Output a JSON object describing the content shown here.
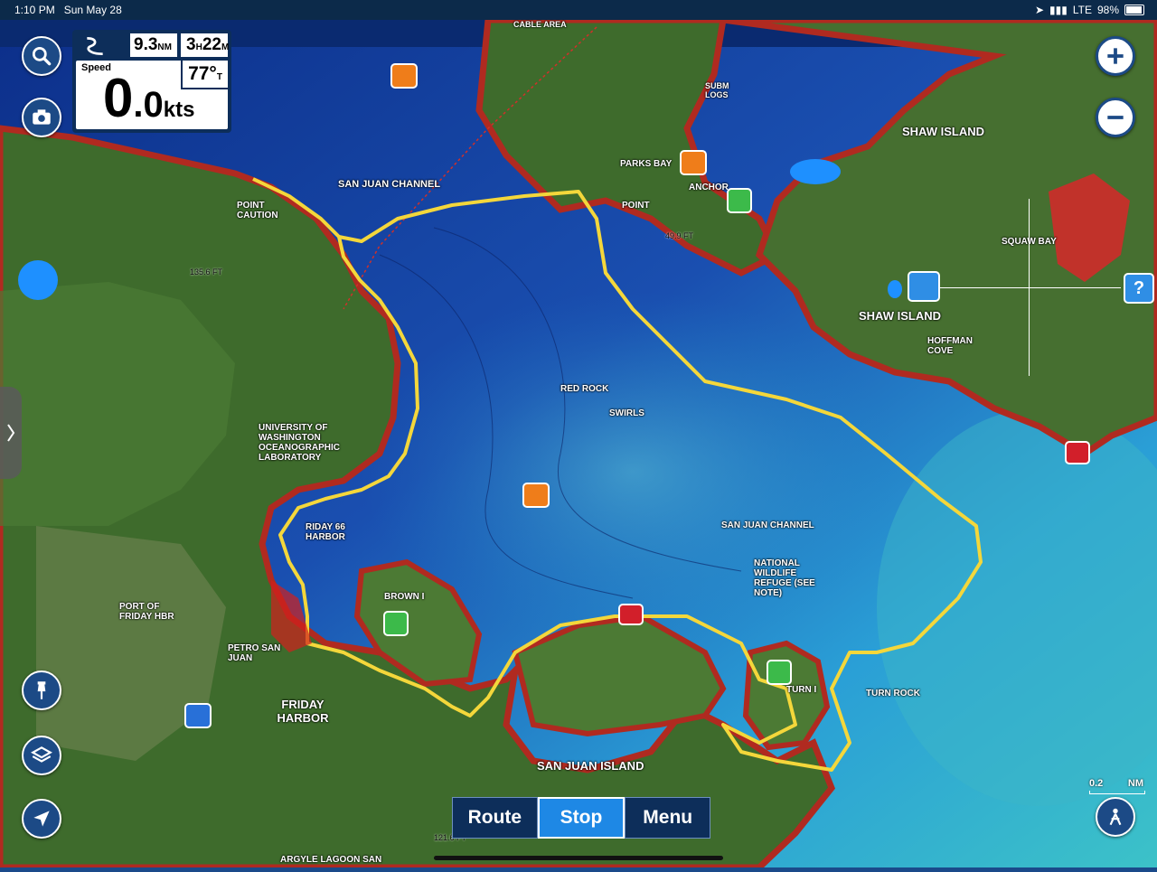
{
  "status_bar": {
    "time": "1:10 PM",
    "date": "Sun May 28",
    "signal": "LTE",
    "battery": "98%"
  },
  "nav_panel": {
    "distance": "9.3",
    "distance_unit": "NM",
    "time_h": "3",
    "time_h_unit": "H",
    "time_m": "22",
    "time_m_unit": "M",
    "speed_label": "Speed",
    "speed_int": "0",
    "speed_dec": ".0",
    "speed_unit": "kts",
    "heading": "77°",
    "heading_ref": "T"
  },
  "bottom_bar": {
    "route": "Route",
    "stop": "Stop",
    "menu": "Menu"
  },
  "scale": {
    "value": "0.2",
    "unit": "NM"
  },
  "map_labels": {
    "san_juan_channel": "SAN JUAN CHANNEL",
    "san_juan_channel_2": "SAN JUAN CHANNEL",
    "shaw_island": "SHAW ISLAND",
    "shaw_island_2": "SHAW ISLAND",
    "squaw_bay": "SQUAW BAY",
    "hoffman_cove": "HOFFMAN COVE",
    "friday_harbor": "FRIDAY HARBOR",
    "friday_harbor_2": "RIDAY 66 HARBOR",
    "port_of_friday_hbr": "PORT OF FRIDAY HBR",
    "petro": "PETRO SAN JUAN",
    "san_juan_island": "SAN JUAN ISLAND",
    "uw_lab": "UNIVERSITY OF WASHINGTON OCEANOGRAPHIC LABORATORY",
    "point_caution": "POINT CAUTION",
    "parks_bay": "PARKS BAY",
    "anchor": "ANCHOR",
    "point": "POINT",
    "brown_i": "BROWN I",
    "turn_i": "TURN I",
    "turn_rock": "TURN ROCK",
    "red_rock": "RED ROCK",
    "swirls": "SWIRLS",
    "wildlife_refuge": "NATIONAL WILDLIFE REFUGE (SEE NOTE)",
    "cable_area": "CABLE AREA",
    "subm_logs": "SUBM LOGS",
    "argyle": "ARGYLE LAGOON SAN",
    "depth_135": "135.6 FT",
    "depth_499": "49.9 FT",
    "depth_1216": "121.6 FT"
  },
  "colors": {
    "panel_bg": "#0d2e5a",
    "button_blue": "#1c4a86",
    "active_blue": "#1e88e5",
    "track_yellow": "#f4d73b",
    "deep_water": "#123a8a",
    "shallow_water": "#2eb0d8",
    "land": "#3e6b2c",
    "shoreline": "#b02a20"
  },
  "icons": [
    "search-icon",
    "camera-icon",
    "pin-icon",
    "layers-icon",
    "locate-arrow-icon",
    "zoom-in-icon",
    "zoom-out-icon",
    "help-icon",
    "weather-icon",
    "person-icon",
    "chevron-right-icon",
    "route-nav-icon"
  ]
}
